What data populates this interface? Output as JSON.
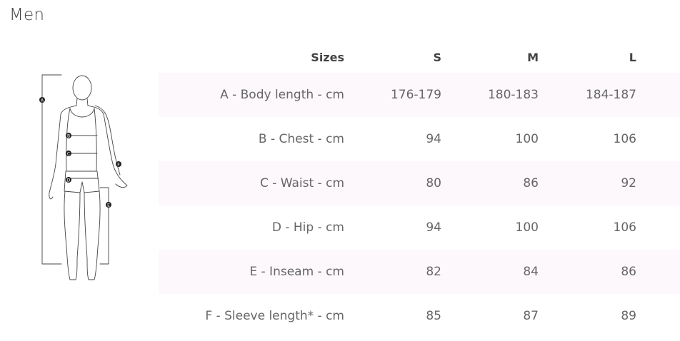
{
  "page": {
    "title": "Men"
  },
  "figure": {
    "markers": [
      "A",
      "B",
      "C",
      "D",
      "E",
      "F"
    ]
  },
  "table": {
    "header": {
      "label": "Sizes",
      "s": "S",
      "m": "M",
      "l": "L"
    },
    "rows": [
      {
        "label": "A - Body length - cm",
        "s": "176-179",
        "m": "180-183",
        "l": "184-187"
      },
      {
        "label": "B - Chest - cm",
        "s": "94",
        "m": "100",
        "l": "106"
      },
      {
        "label": "C - Waist - cm",
        "s": "80",
        "m": "86",
        "l": "92"
      },
      {
        "label": "D - Hip - cm",
        "s": "94",
        "m": "100",
        "l": "106"
      },
      {
        "label": "E - Inseam - cm",
        "s": "82",
        "m": "84",
        "l": "86"
      },
      {
        "label": "F - Sleeve length* - cm",
        "s": "85",
        "m": "87",
        "l": "89"
      }
    ]
  }
}
